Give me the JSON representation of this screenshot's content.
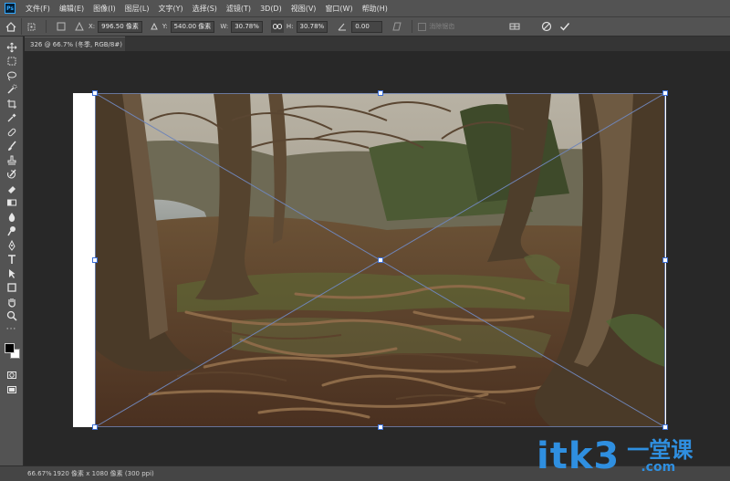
{
  "app": {
    "logo": "Ps",
    "menu": [
      "文件(F)",
      "编辑(E)",
      "图像(I)",
      "图层(L)",
      "文字(Y)",
      "选择(S)",
      "滤镜(T)",
      "3D(D)",
      "视图(V)",
      "窗口(W)",
      "帮助(H)"
    ]
  },
  "options": {
    "x_label": "X:",
    "x_value": "996.50 像素",
    "y_label": "Y:",
    "y_value": "540.00 像素",
    "w_label": "W:",
    "w_value": "30.78%",
    "h_label": "H:",
    "h_value": "30.78%",
    "angle_value": "0.00",
    "anti_alias": "消除锯齿"
  },
  "document": {
    "tab_title": "326 @ 66.7% (冬季, RGB/8#)"
  },
  "status": {
    "zoom": "66.67%",
    "info": "1920 像素 x 1080 像素 (300 ppi)"
  },
  "watermark": {
    "text": "itk3",
    "cn": "一堂课",
    "sub": ".com"
  },
  "colors": {
    "foreground": "#000000",
    "background": "#ffffff",
    "accent": "#3b6fd8"
  },
  "tools": [
    "move-tool",
    "marquee-tool",
    "lasso-tool",
    "quick-select-tool",
    "crop-tool",
    "eyedropper-tool",
    "healing-tool",
    "brush-tool",
    "stamp-tool",
    "history-brush-tool",
    "eraser-tool",
    "gradient-tool",
    "blur-tool",
    "dodge-tool",
    "pen-tool",
    "type-tool",
    "path-select-tool",
    "shape-tool",
    "hand-tool",
    "zoom-tool",
    "more-tools"
  ]
}
